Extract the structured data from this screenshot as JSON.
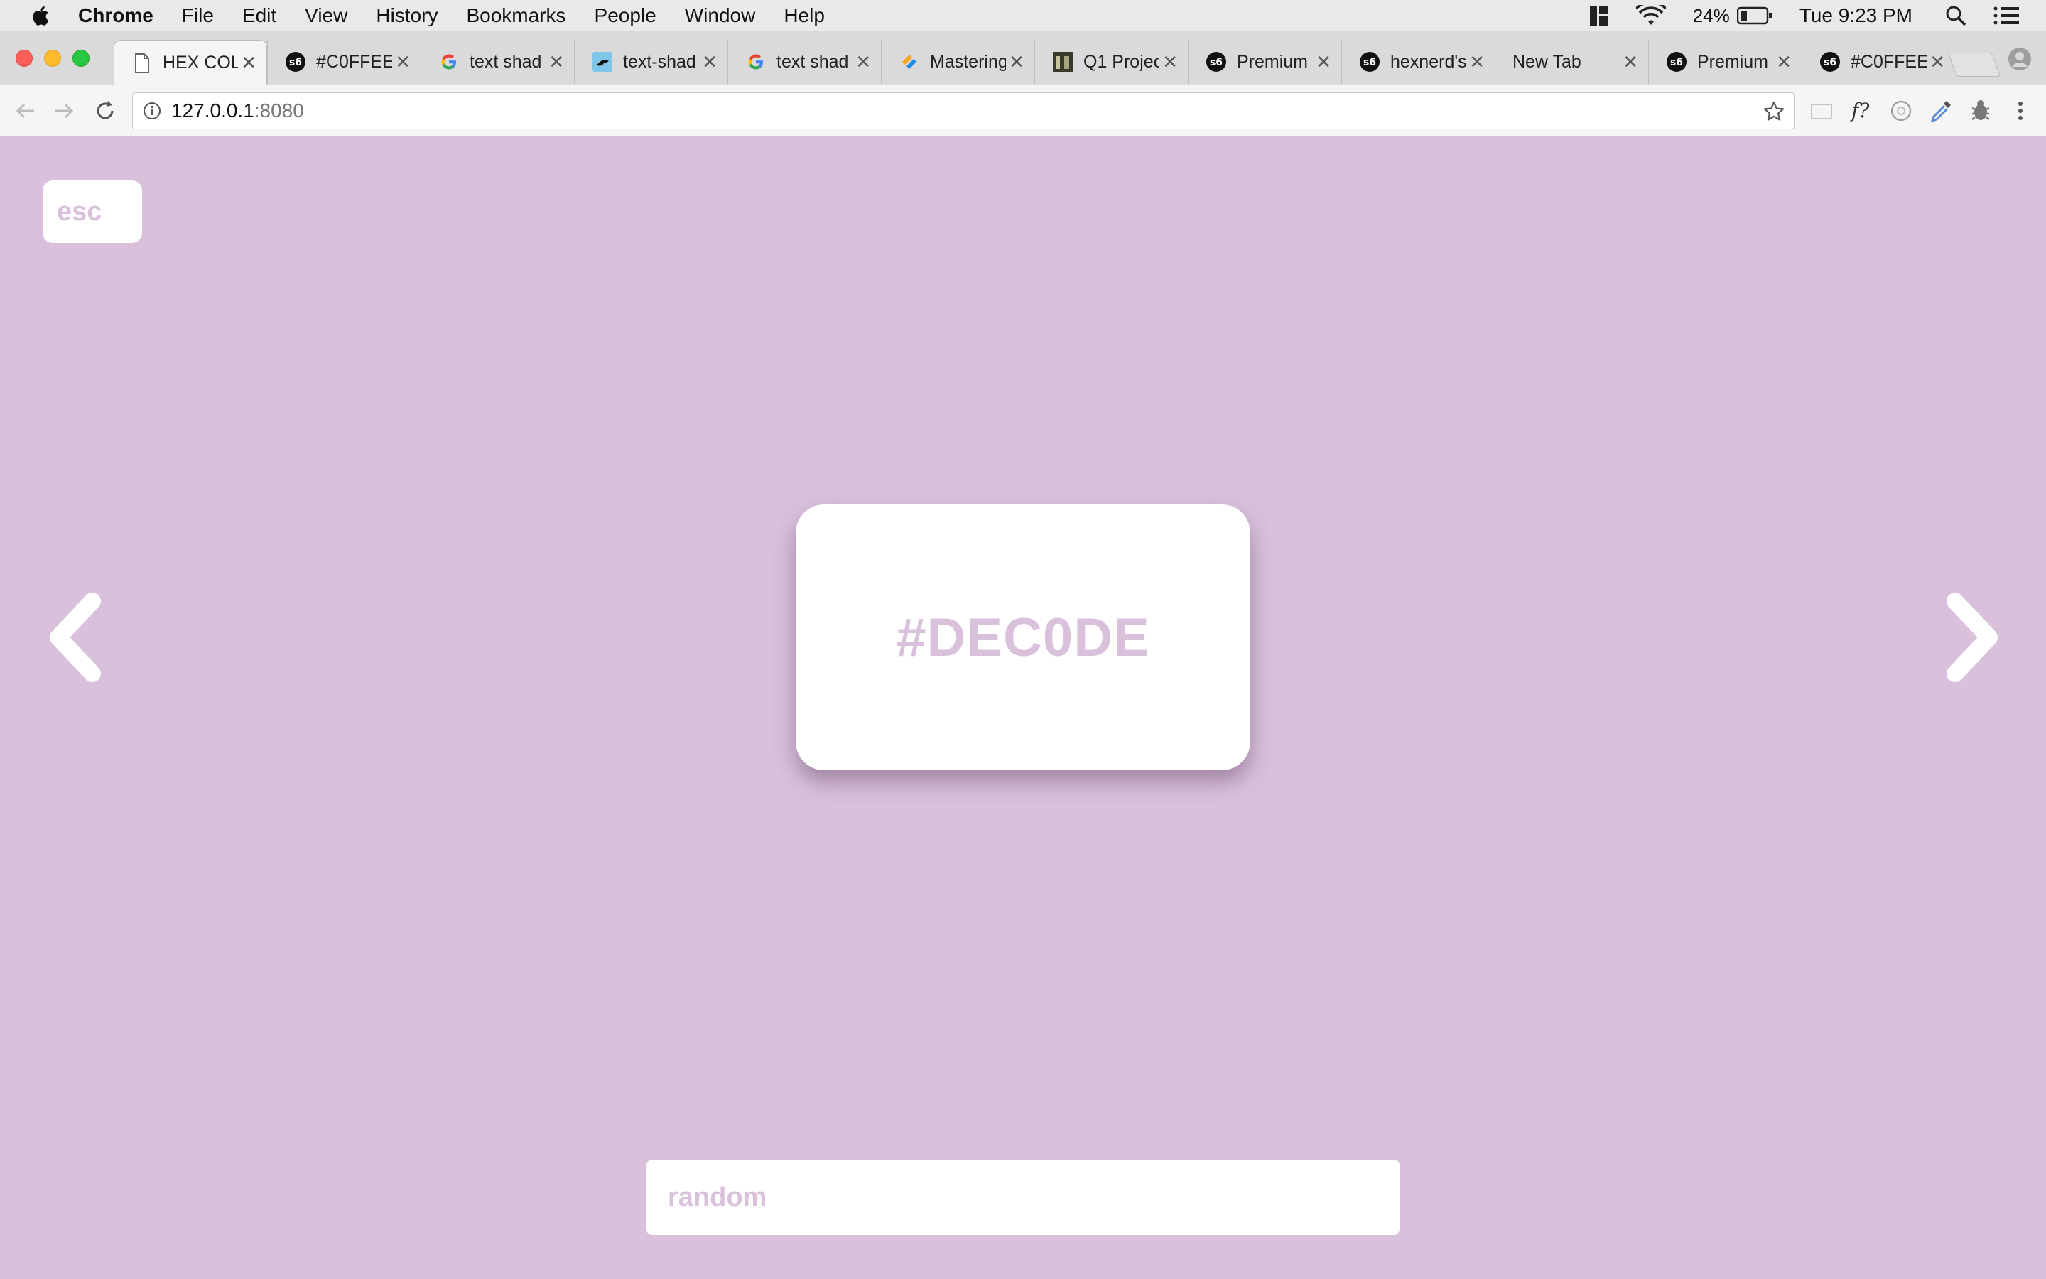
{
  "menubar": {
    "app": "Chrome",
    "items": [
      "File",
      "Edit",
      "View",
      "History",
      "Bookmarks",
      "People",
      "Window",
      "Help"
    ],
    "battery": "24%",
    "clock": "Tue 9:23 PM"
  },
  "tabs": [
    {
      "title": "HEX COL",
      "icon": "document-icon"
    },
    {
      "title": "#C0FFEE",
      "icon": "s6-logo-icon"
    },
    {
      "title": "text shad",
      "icon": "google-icon"
    },
    {
      "title": "text-shad",
      "icon": "bird-icon"
    },
    {
      "title": "text shad",
      "icon": "google-icon"
    },
    {
      "title": "Mastering",
      "icon": "tool-icon"
    },
    {
      "title": "Q1 Projec",
      "icon": "photo-icon"
    },
    {
      "title": "Premium",
      "icon": "s6-logo-icon"
    },
    {
      "title": "hexnerd's",
      "icon": "s6-logo-icon"
    },
    {
      "title": "New Tab",
      "icon": "none"
    },
    {
      "title": "Premium",
      "icon": "s6-logo-icon"
    },
    {
      "title": "#C0FFEE",
      "icon": "s6-logo-icon"
    }
  ],
  "address_bar": {
    "host": "127.0.0.1",
    "port": ":8080"
  },
  "page": {
    "background": "#d9c1dc",
    "esc_label": "esc",
    "hex_code": "#DEC0DE",
    "random_label": "random"
  }
}
